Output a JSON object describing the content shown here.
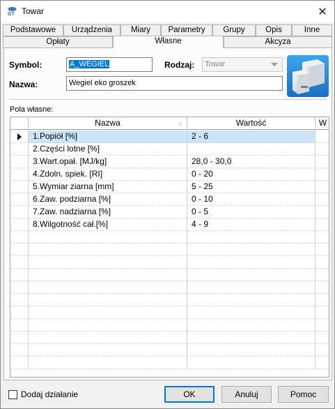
{
  "window": {
    "title": "Towar",
    "app_icon": "gt-app-icon",
    "close_icon": "close-icon",
    "close_glyph": "✕"
  },
  "tabs_row1": [
    {
      "label": "Podstawowe"
    },
    {
      "label": "Urządzenia"
    },
    {
      "label": "Miary"
    },
    {
      "label": "Parametry"
    },
    {
      "label": "Grupy"
    },
    {
      "label": "Opis"
    },
    {
      "label": "Inne"
    }
  ],
  "tabs_row2": [
    {
      "label": "Opłaty"
    },
    {
      "label": "Własne",
      "active": true
    },
    {
      "label": "Akcyza"
    }
  ],
  "form": {
    "symbol_label": "Symbol:",
    "symbol_value": "A_WEGIEL",
    "rodzaj_label": "Rodzaj:",
    "rodzaj_value": "Towar",
    "nazwa_label": "Nazwa:",
    "nazwa_value": "Wegiel eko groszek",
    "product_icon": "product-boxes-icon"
  },
  "custom_fields": {
    "title": "Pola własne:",
    "columns": [
      "Nazwa",
      "Wartość",
      "W"
    ],
    "rows": [
      {
        "name": "1.Popiół [%]",
        "value": "2 - 6"
      },
      {
        "name": "2.Części lotne [%]",
        "value": ""
      },
      {
        "name": "3.Wart.opał. [MJ/kg]",
        "value": "28,0 - 30,0"
      },
      {
        "name": "4.Zdoln. spiek. [RI]",
        "value": "0 - 20"
      },
      {
        "name": "5.Wymiar ziarna [mm]",
        "value": "5 - 25"
      },
      {
        "name": "6.Zaw. podziarna [%]",
        "value": "0 - 10"
      },
      {
        "name": "7.Zaw. nadziarna [%]",
        "value": "0 - 5"
      },
      {
        "name": "8.Wilgotność cał.[%]",
        "value": "4 - 9"
      }
    ],
    "selected_row": 0,
    "empty_rows": 11
  },
  "footer": {
    "checkbox_label": "Dodaj działanie",
    "checkbox_checked": false,
    "ok_label": "OK",
    "cancel_label": "Anuluj",
    "help_label": "Pomoc"
  },
  "colors": {
    "selection": "#0078d7",
    "selected_row": "#cce4f7",
    "window_bg": "#f0f0f0"
  }
}
